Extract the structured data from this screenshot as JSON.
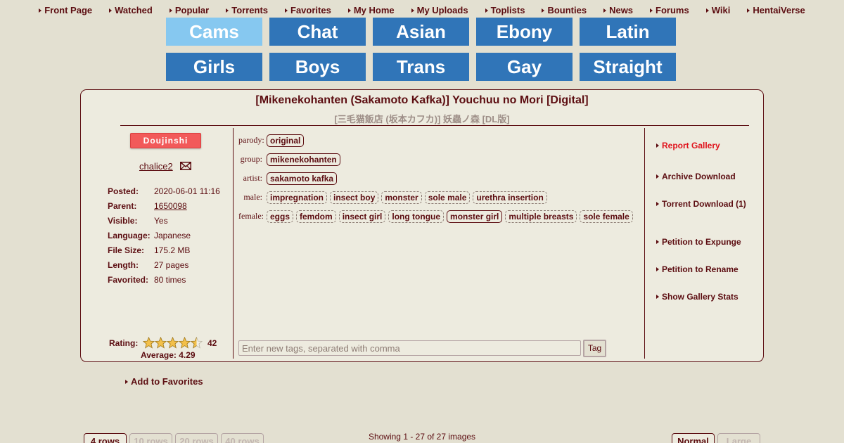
{
  "nav": [
    "Front Page",
    "Watched",
    "Popular",
    "Torrents",
    "Favorites",
    "My Home",
    "My Uploads",
    "Toplists",
    "Bounties",
    "News",
    "Forums",
    "Wiki",
    "HentaiVerse"
  ],
  "tiles": [
    "Cams",
    "Chat",
    "Asian",
    "Ebony",
    "Latin",
    "Girls",
    "Boys",
    "Trans",
    "Gay",
    "Straight"
  ],
  "gallery": {
    "title": "[Mikenekohanten (Sakamoto Kafka)] Youchuu no Mori [Digital]",
    "subtitle": "[三毛猫飯店 (坂本カフカ)] 妖蟲ノ森 [DL版]",
    "category": "Doujinshi",
    "uploader": "chalice2",
    "meta": {
      "posted_label": "Posted:",
      "posted": "2020-06-01 11:16",
      "parent_label": "Parent:",
      "parent": "1650098",
      "visible_label": "Visible:",
      "visible": "Yes",
      "language_label": "Language:",
      "language": "Japanese",
      "filesize_label": "File Size:",
      "filesize": "175.2 MB",
      "length_label": "Length:",
      "length": "27 pages",
      "favorited_label": "Favorited:",
      "favorited": "80 times"
    },
    "rating": {
      "label": "Rating:",
      "count": "42",
      "average": "Average: 4.29",
      "value": 4.29
    },
    "add_favorites": "Add to Favorites"
  },
  "tags": {
    "parody_label": "parody:",
    "parody": [
      "original"
    ],
    "group_label": "group:",
    "group": [
      "mikenekohanten"
    ],
    "artist_label": "artist:",
    "artist": [
      "sakamoto kafka"
    ],
    "male_label": "male:",
    "male": [
      "impregnation",
      "insect boy",
      "monster",
      "sole male",
      "urethra insertion"
    ],
    "female_label": "female:",
    "female": [
      "eggs",
      "femdom",
      "insect girl",
      "long tongue",
      "monster girl",
      "multiple breasts",
      "sole female"
    ],
    "new_tag_placeholder": "Enter new tags, separated with comma",
    "tag_button": "Tag"
  },
  "actions": {
    "report": "Report Gallery",
    "archive": "Archive Download",
    "torrent": "Torrent Download (1)",
    "expunge": "Petition to Expunge",
    "rename": "Petition to Rename",
    "stats": "Show Gallery Stats"
  },
  "bottom": {
    "rows": [
      "4 rows",
      "10 rows",
      "20 rows",
      "40 rows"
    ],
    "showing": "Showing 1 - 27 of 27 images",
    "sizes": [
      "Normal",
      "Large"
    ]
  },
  "colors": {
    "text": "#5c0d11",
    "background": "#e3e0d1",
    "panel": "#edebdf",
    "tile_blue": "#3075b8",
    "tile_light_blue": "#86c8f0",
    "category_red": "#f25a5a",
    "report_red": "#e0131c"
  }
}
